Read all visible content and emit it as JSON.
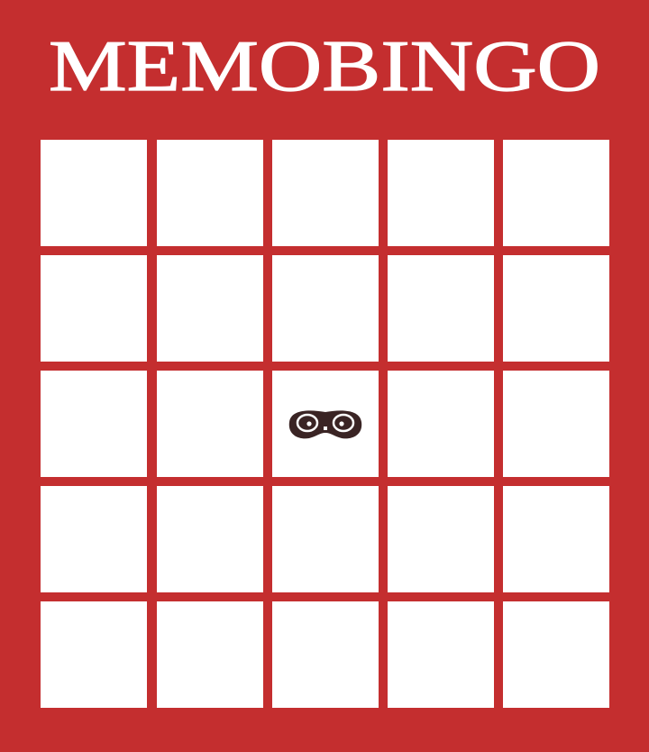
{
  "card": {
    "title": "MEMOBINGO",
    "background_color": "#c42e2f",
    "cell_color": "#ffffff",
    "rows": 5,
    "columns": 5,
    "cells": [
      [
        "",
        "",
        "",
        "",
        ""
      ],
      [
        "",
        "",
        "",
        "",
        ""
      ],
      [
        "",
        "",
        "free-space-mask-icon",
        "",
        ""
      ],
      [
        "",
        "",
        "",
        "",
        ""
      ],
      [
        "",
        "",
        "",
        "",
        ""
      ]
    ]
  }
}
